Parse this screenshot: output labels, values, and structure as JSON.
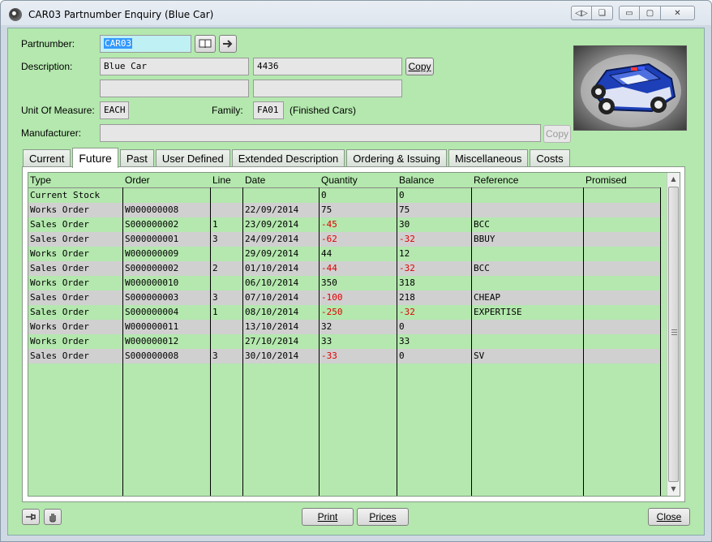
{
  "window": {
    "title": "CAR03 Partnumber Enquiry (Blue Car)",
    "controls": {
      "restore_tile": "◁▷",
      "help": "❏",
      "minimize": "▭",
      "maximize": "▢",
      "close": "✕"
    }
  },
  "form": {
    "partnumber_label": "Partnumber:",
    "partnumber_value": "CAR03",
    "description_label": "Description:",
    "description_value": "Blue Car",
    "description_code": "4436",
    "description_line2a": "",
    "description_line2b": "",
    "copy_label": "Copy",
    "uom_label": "Unit Of Measure:",
    "uom_value": "EACH",
    "family_label": "Family:",
    "family_value": "FA01",
    "family_desc": "(Finished Cars)",
    "manufacturer_label": "Manufacturer:",
    "manufacturer_value": "",
    "manufacturer_copy_label": "Copy"
  },
  "tabs": [
    {
      "label": "Current"
    },
    {
      "label": "Future"
    },
    {
      "label": "Past"
    },
    {
      "label": "User Defined"
    },
    {
      "label": "Extended Description"
    },
    {
      "label": "Ordering & Issuing"
    },
    {
      "label": "Miscellaneous"
    },
    {
      "label": "Costs"
    }
  ],
  "active_tab": "Future",
  "grid": {
    "headers": [
      "Type",
      "Order",
      "Line",
      "Date",
      "Quantity",
      "Balance",
      "Reference",
      "Promised"
    ],
    "rows": [
      {
        "type": "Current Stock",
        "order": "",
        "line": "",
        "date": "",
        "quantity": "0",
        "balance": "0",
        "reference": "",
        "promised": ""
      },
      {
        "type": "Works Order",
        "order": "W000000008",
        "line": "",
        "date": "22/09/2014",
        "quantity": "75",
        "balance": "75",
        "reference": "",
        "promised": ""
      },
      {
        "type": "Sales Order",
        "order": "S000000002",
        "line": "1",
        "date": "23/09/2014",
        "quantity": "-45",
        "balance": "30",
        "reference": "BCC",
        "promised": ""
      },
      {
        "type": "Sales Order",
        "order": "S000000001",
        "line": "3",
        "date": "24/09/2014",
        "quantity": "-62",
        "balance": "-32",
        "reference": "BBUY",
        "promised": ""
      },
      {
        "type": "Works Order",
        "order": "W000000009",
        "line": "",
        "date": "29/09/2014",
        "quantity": "44",
        "balance": "12",
        "reference": "",
        "promised": ""
      },
      {
        "type": "Sales Order",
        "order": "S000000002",
        "line": "2",
        "date": "01/10/2014",
        "quantity": "-44",
        "balance": "-32",
        "reference": "BCC",
        "promised": ""
      },
      {
        "type": "Works Order",
        "order": "W000000010",
        "line": "",
        "date": "06/10/2014",
        "quantity": "350",
        "balance": "318",
        "reference": "",
        "promised": ""
      },
      {
        "type": "Sales Order",
        "order": "S000000003",
        "line": "3",
        "date": "07/10/2014",
        "quantity": "-100",
        "balance": "218",
        "reference": "CHEAP",
        "promised": ""
      },
      {
        "type": "Sales Order",
        "order": "S000000004",
        "line": "1",
        "date": "08/10/2014",
        "quantity": "-250",
        "balance": "-32",
        "reference": "EXPERTISE",
        "promised": ""
      },
      {
        "type": "Works Order",
        "order": "W000000011",
        "line": "",
        "date": "13/10/2014",
        "quantity": "32",
        "balance": "0",
        "reference": "",
        "promised": ""
      },
      {
        "type": "Works Order",
        "order": "W000000012",
        "line": "",
        "date": "27/10/2014",
        "quantity": "33",
        "balance": "33",
        "reference": "",
        "promised": ""
      },
      {
        "type": "Sales Order",
        "order": "S000000008",
        "line": "3",
        "date": "30/10/2014",
        "quantity": "-33",
        "balance": "0",
        "reference": "SV",
        "promised": ""
      }
    ]
  },
  "buttons": {
    "print": "Print",
    "prices": "Prices",
    "close": "Close"
  },
  "colors": {
    "background": "#b4e8ae",
    "alt_row": "#d0d0d0",
    "negative": "#e00000",
    "active_field": "#bff0f4"
  }
}
